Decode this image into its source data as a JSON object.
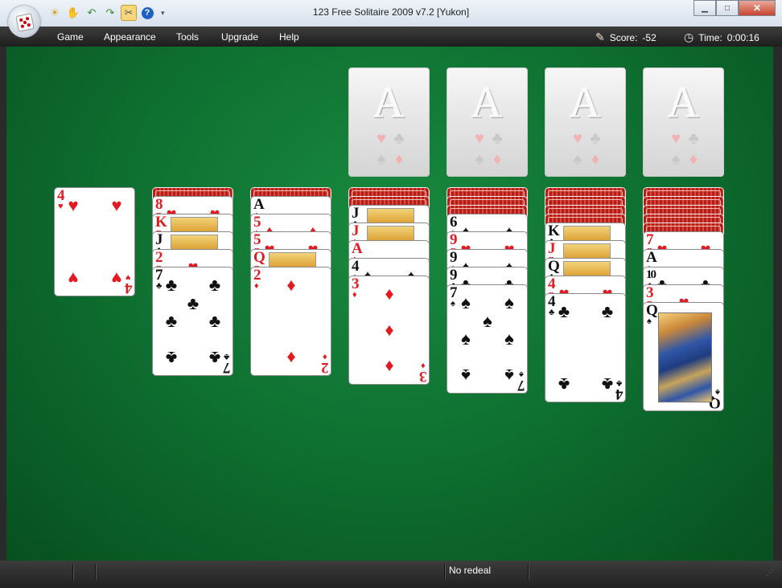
{
  "window": {
    "title": "123 Free Solitaire 2009 v7.2  [Yukon]"
  },
  "quick_access": [
    {
      "icon": "sun-icon",
      "glyph": "☀",
      "color": "#d7a31a"
    },
    {
      "icon": "hand-icon",
      "glyph": "✋",
      "color": "#d6a84a"
    },
    {
      "icon": "undo-icon",
      "glyph": "↶",
      "color": "#3a8a2a"
    },
    {
      "icon": "redo-icon",
      "glyph": "↷",
      "color": "#3a8a2a"
    },
    {
      "icon": "tools-icon",
      "glyph": "✂",
      "color": "#555555"
    },
    {
      "icon": "help-icon",
      "glyph": "?",
      "color": "#1f5fbf"
    }
  ],
  "menu": {
    "items": [
      "Game",
      "Appearance",
      "Tools",
      "Upgrade",
      "Help"
    ]
  },
  "score": {
    "label": "Score:",
    "value": "-52"
  },
  "time": {
    "label": "Time:",
    "value": "0:00:16"
  },
  "status": {
    "redeal": "No redeal"
  },
  "foundations": [
    {
      "label": "A",
      "suits": [
        "♥",
        "♣",
        "♠",
        "♦"
      ]
    },
    {
      "label": "A",
      "suits": [
        "♥",
        "♣",
        "♠",
        "♦"
      ]
    },
    {
      "label": "A",
      "suits": [
        "♥",
        "♣",
        "♠",
        "♦"
      ]
    },
    {
      "label": "A",
      "suits": [
        "♥",
        "♣",
        "♠",
        "♦"
      ]
    }
  ],
  "tableau": [
    {
      "hidden": 0,
      "cards": [
        {
          "rank": "4",
          "suit": "♥"
        }
      ]
    },
    {
      "hidden": 1,
      "cards": [
        {
          "rank": "8",
          "suit": "♥"
        },
        {
          "rank": "K",
          "suit": "♥"
        },
        {
          "rank": "J",
          "suit": "♣"
        },
        {
          "rank": "2",
          "suit": "♥"
        },
        {
          "rank": "7",
          "suit": "♣"
        }
      ]
    },
    {
      "hidden": 1,
      "cards": [
        {
          "rank": "A",
          "suit": "♠"
        },
        {
          "rank": "5",
          "suit": "♦"
        },
        {
          "rank": "5",
          "suit": "♥"
        },
        {
          "rank": "Q",
          "suit": "♥"
        },
        {
          "rank": "2",
          "suit": "♦"
        }
      ]
    },
    {
      "hidden": 2,
      "cards": [
        {
          "rank": "J",
          "suit": "♣"
        },
        {
          "rank": "J",
          "suit": "♦"
        },
        {
          "rank": "A",
          "suit": "♦"
        },
        {
          "rank": "4",
          "suit": "♠"
        },
        {
          "rank": "3",
          "suit": "♦"
        }
      ]
    },
    {
      "hidden": 3,
      "cards": [
        {
          "rank": "6",
          "suit": "♠"
        },
        {
          "rank": "9",
          "suit": "♥"
        },
        {
          "rank": "9",
          "suit": "♠"
        },
        {
          "rank": "9",
          "suit": "♣"
        },
        {
          "rank": "7",
          "suit": "♠"
        }
      ]
    },
    {
      "hidden": 4,
      "cards": [
        {
          "rank": "K",
          "suit": "♣"
        },
        {
          "rank": "J",
          "suit": "♥"
        },
        {
          "rank": "Q",
          "suit": "♣"
        },
        {
          "rank": "4",
          "suit": "♥"
        },
        {
          "rank": "4",
          "suit": "♣"
        }
      ]
    },
    {
      "hidden": 5,
      "cards": [
        {
          "rank": "7",
          "suit": "♥"
        },
        {
          "rank": "A",
          "suit": "♠"
        },
        {
          "rank": "10",
          "suit": "♣"
        },
        {
          "rank": "3",
          "suit": "♥"
        },
        {
          "rank": "Q",
          "suit": "♠"
        }
      ]
    }
  ]
}
